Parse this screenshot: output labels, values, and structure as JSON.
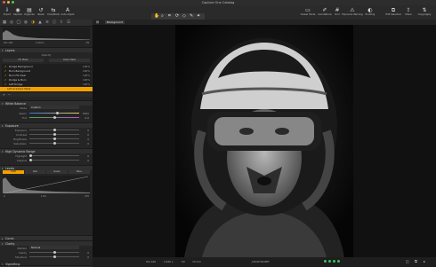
{
  "window": {
    "title": "Capture One Catalog"
  },
  "colors": {
    "accent": "#f2a100",
    "selection": "#f2a100",
    "bg": "#1b1b1b"
  },
  "toolbar": {
    "left": [
      {
        "icon": "import-icon",
        "label": "Import"
      },
      {
        "icon": "capture-icon",
        "label": "Capture"
      },
      {
        "icon": "organize-icon",
        "label": "Organize"
      },
      {
        "icon": "reset-icon",
        "label": "Reset"
      },
      {
        "icon": "undo-redo-icon",
        "label": "Undo/Redo"
      },
      {
        "icon": "auto-adjust-icon",
        "label": "Auto Adjust"
      }
    ],
    "cursor_tools_label": "Cursor Tools",
    "right": [
      {
        "icon": "viewer-mode-icon",
        "label": "Viewer Mode"
      },
      {
        "icon": "annotations-icon",
        "label": "Annotations"
      },
      {
        "icon": "grid-icon",
        "label": "Grid"
      },
      {
        "icon": "exposure-warning-icon",
        "label": "Exposure Warning"
      },
      {
        "icon": "proofing-icon",
        "label": "Proofing"
      },
      {
        "icon": "edit-selected-icon",
        "label": "Edit Selected"
      },
      {
        "icon": "share-icon",
        "label": "Share"
      },
      {
        "icon": "copy-apply-icon",
        "label": "Copy/Apply"
      }
    ]
  },
  "histogram": {
    "left_val": "ISO 160",
    "mid_val": "1/160 s",
    "right_val": "f/9"
  },
  "layers": {
    "title": "Layers",
    "subtitle": "Opacity",
    "buttons": [
      "Fill Mask",
      "Clear Mask"
    ],
    "items": [
      {
        "name": "Dodge Background",
        "pct": "100%"
      },
      {
        "name": "Burn Background",
        "pct": "100%"
      },
      {
        "name": "Burn Fill Clear",
        "pct": "100%"
      },
      {
        "name": "Dodge & Burn",
        "pct": "100%"
      },
      {
        "name": "Left Dodge",
        "pct": "100%"
      }
    ],
    "selected": "Left Gradient Mask"
  },
  "white_balance": {
    "title": "White Balance",
    "mode_label": "Mode",
    "mode_value": "Custom",
    "rows": [
      {
        "label": "Kelvin",
        "value": "5950"
      },
      {
        "label": "Tint",
        "value": "0.0"
      }
    ]
  },
  "exposure": {
    "title": "Exposure",
    "rows": [
      {
        "label": "Exposure",
        "value": "0"
      },
      {
        "label": "Contrast",
        "value": "0"
      },
      {
        "label": "Brightness",
        "value": "0"
      },
      {
        "label": "Saturation",
        "value": "0"
      }
    ]
  },
  "hdr": {
    "title": "High Dynamic Range",
    "rows": [
      {
        "label": "Highlight",
        "value": "0"
      },
      {
        "label": "Shadow",
        "value": "0"
      }
    ]
  },
  "levels": {
    "title": "Levels",
    "channels": [
      "RGB",
      "Red",
      "Green",
      "Blue"
    ],
    "selected_channel": "RGB",
    "low": "0",
    "mid": "1.00",
    "high": "255"
  },
  "curve": {
    "title": "Curve"
  },
  "clarity": {
    "title": "Clarity",
    "method_label": "Method",
    "method_value": "Natural",
    "rows": [
      {
        "label": "Clarity",
        "value": "0"
      },
      {
        "label": "Structure",
        "value": "0"
      }
    ]
  },
  "vignetting": {
    "title": "Vignetting",
    "amount_label": "Amount",
    "amount_value": "0",
    "method_label": "Method",
    "method_value": "Elliptic on Crop"
  },
  "viewer": {
    "image_name": "Background"
  },
  "footer": {
    "iso": "ISO 160",
    "shutter": "1/160 s",
    "aperture": "f/9",
    "focal": "70 mm",
    "filename": "_DSC8709.NEF"
  }
}
